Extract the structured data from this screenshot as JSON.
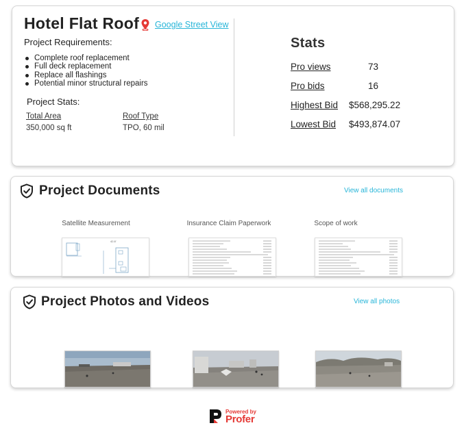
{
  "overview": {
    "title": "Hotel Flat Roof",
    "street_view_link": "Google Street View",
    "requirements_title": "Project Requirements:",
    "requirements": [
      "Complete roof replacement",
      "Full deck replacement",
      "Replace all flashings",
      "Potential minor structural repairs"
    ],
    "project_stats_title": "Project Stats:",
    "project_stats": [
      {
        "label": "Total Area",
        "value": "350,000 sq ft"
      },
      {
        "label": "Roof Type",
        "value": "TPO, 60 mil"
      }
    ]
  },
  "stats": {
    "title": "Stats",
    "rows": [
      {
        "label": "Pro views",
        "value": "73"
      },
      {
        "label": "Pro bids",
        "value": "16"
      },
      {
        "label": "Highest Bid",
        "value": "$568,295.22"
      },
      {
        "label": "Lowest Bid",
        "value": "$493,874.07"
      }
    ]
  },
  "documents": {
    "title": "Project Documents",
    "view_all": "View all documents",
    "items": [
      {
        "label": "Satellite Measurement"
      },
      {
        "label": "Insurance Claim Paperwork"
      },
      {
        "label": "Scope of work"
      }
    ]
  },
  "photos": {
    "title": "Project Photos and Videos",
    "view_all": "View all photos"
  },
  "footer": {
    "powered_by": "Powered by",
    "brand": "Profer"
  },
  "colors": {
    "link": "#27b5d8",
    "brand_red": "#e53935",
    "pin_red": "#e53935"
  }
}
